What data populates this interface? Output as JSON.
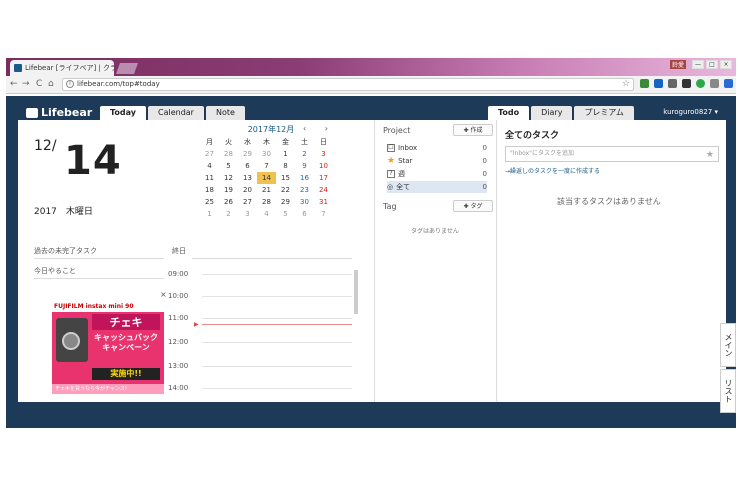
{
  "browser": {
    "tab_title": "Lifebear [ライフベア] | クラ",
    "tab_close": "×",
    "user_badge": "鈴愛",
    "win_min": "—",
    "win_max": "□",
    "win_close": "×",
    "back": "←",
    "forward": "→",
    "reload": "C",
    "home": "⌂",
    "url": "lifebear.com/top#today",
    "info_icon": "i",
    "star": "☆",
    "extra": "ク"
  },
  "app": {
    "logo": "Lifebear",
    "left_tabs": [
      "Today",
      "Calendar",
      "Note"
    ],
    "right_tabs": [
      "Todo",
      "Diary",
      "プレミアム"
    ],
    "user_menu": "kuroguro0827 ▾"
  },
  "today": {
    "month_day": "12/",
    "day": "14",
    "year_weekday": "2017　木曜日"
  },
  "calendar": {
    "title": "2017年12月",
    "nav": "‹ ›",
    "weekdays": [
      "月",
      "火",
      "水",
      "木",
      "金",
      "土",
      "日"
    ],
    "weeks": [
      [
        "27",
        "28",
        "29",
        "30",
        "1",
        "2",
        "3"
      ],
      [
        "4",
        "5",
        "6",
        "7",
        "8",
        "9",
        "10"
      ],
      [
        "11",
        "12",
        "13",
        "14",
        "15",
        "16",
        "17"
      ],
      [
        "18",
        "19",
        "20",
        "21",
        "22",
        "23",
        "24"
      ],
      [
        "25",
        "26",
        "27",
        "28",
        "29",
        "30",
        "31"
      ],
      [
        "1",
        "2",
        "3",
        "4",
        "5",
        "6",
        "7"
      ]
    ]
  },
  "left": {
    "past_tasks": "過去の未完了タスク",
    "today_tasks": "今日やること",
    "allday": "終日",
    "hours": [
      "09:00",
      "10:00",
      "11:00",
      "12:00",
      "13:00",
      "14:00"
    ],
    "ad_close": "×"
  },
  "ad": {
    "brand": "FUJIFILM instax mini 90",
    "product": "チェキ",
    "campaign": "キャッシュバックキャンペーン",
    "cta": "実施中!!",
    "footer": "チェキを買うなら今がチャンス!"
  },
  "project": {
    "title": "Project",
    "create_btn": "✚ 作成",
    "items": [
      {
        "label": "Inbox",
        "count": "0",
        "icon": "☐"
      },
      {
        "label": "Star",
        "count": "0",
        "icon": "★"
      },
      {
        "label": "週",
        "count": "0",
        "icon": "?"
      },
      {
        "label": "全て",
        "count": "0",
        "icon": "◎"
      }
    ],
    "tag_title": "Tag",
    "tag_btn": "✚ タグ",
    "tag_empty": "タグはありません"
  },
  "todo": {
    "title": "全てのタスク",
    "placeholder": "\"Inbox\"にタスクを追加",
    "add_star": "★",
    "add_link": "→繰返しのタスクを一度に作成する",
    "empty": "該当するタスクはありません"
  },
  "side": {
    "tab1": "メイン",
    "tab2": "リスト"
  }
}
